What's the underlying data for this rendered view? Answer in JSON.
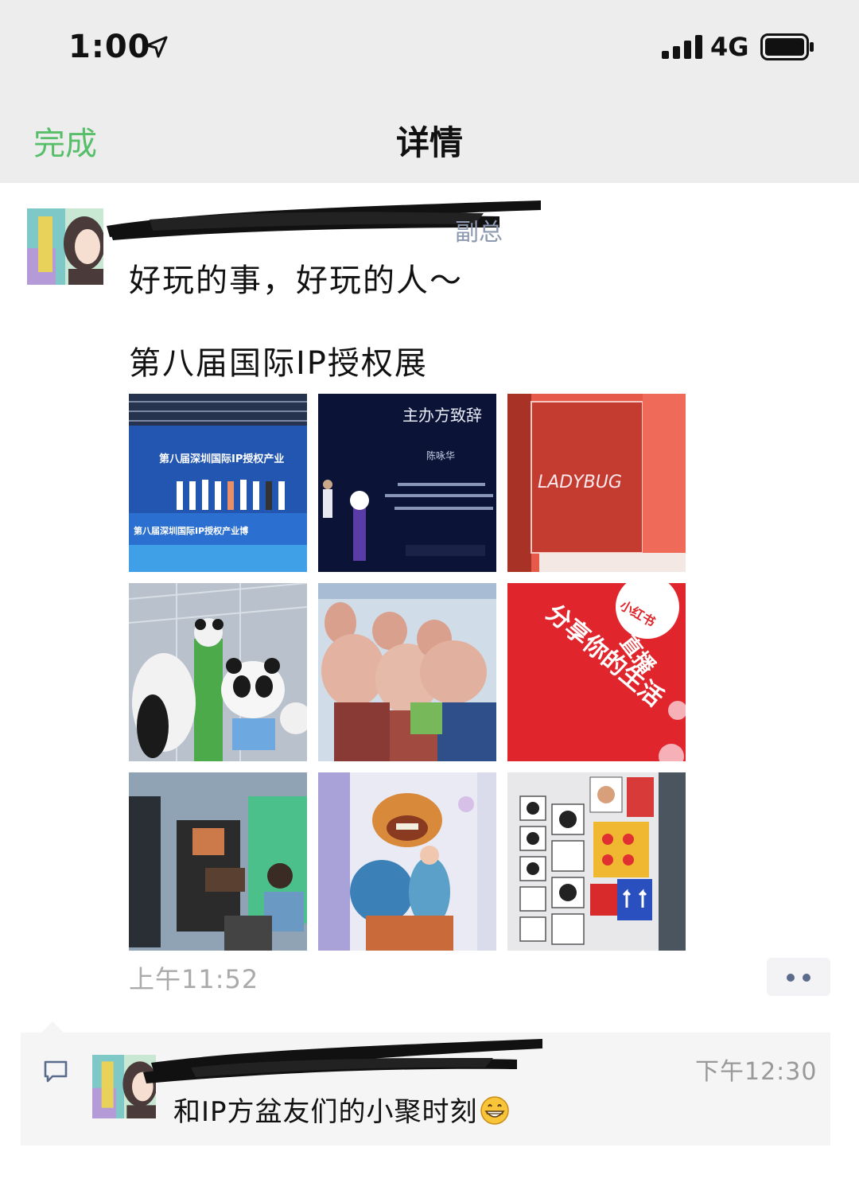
{
  "status_bar": {
    "time": "1:00",
    "network": "4G"
  },
  "nav": {
    "done_label": "完成",
    "title": "详情"
  },
  "post": {
    "line1": "好玩的事，好玩的人～",
    "line2": "第八届国际IP授权展",
    "time": "上午11:52",
    "photos": [
      {
        "icon": "stage-ceremony-photo",
        "banner": "第八届深圳国际IP授权产业",
        "bottom": "第八届深圳国际IP授权产业博"
      },
      {
        "icon": "speech-photo",
        "caption": "主办方致辞",
        "name": "陈咏华"
      },
      {
        "icon": "ladybug-booth-photo",
        "neon": "LADYBUG"
      },
      {
        "icon": "panda-mascot-photo"
      },
      {
        "icon": "mouse-costume-photo"
      },
      {
        "icon": "xiaohongshu-wall-photo",
        "text1": "分享你的生活",
        "text2": "直播",
        "text3": "小红书"
      },
      {
        "icon": "camera-equipment-photo"
      },
      {
        "icon": "dragon-artwork-photo"
      },
      {
        "icon": "product-display-photo"
      }
    ]
  },
  "comment": {
    "time": "下午12:30",
    "text": "和IP方盆友们的小聚时刻",
    "emoji": "grinning-face-icon"
  },
  "colors": {
    "accent_green": "#57be6a",
    "link_blue": "#5b6b8c",
    "nav_bg": "#ededed"
  }
}
